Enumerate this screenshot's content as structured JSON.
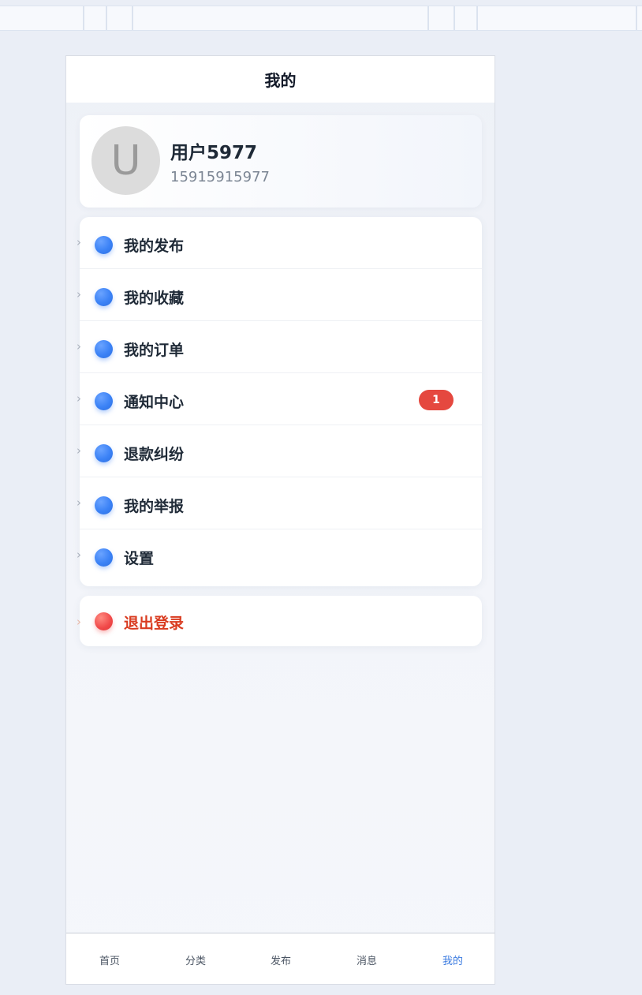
{
  "header": {
    "title": "我的"
  },
  "profile": {
    "avatar_letter": "U",
    "username": "用户5977",
    "phone": "15915915977"
  },
  "menu": [
    {
      "label": "我的发布",
      "icon": "blue-dot-icon"
    },
    {
      "label": "我的收藏",
      "icon": "blue-dot-icon"
    },
    {
      "label": "我的订单",
      "icon": "blue-dot-icon"
    },
    {
      "label": "通知中心",
      "icon": "blue-dot-icon",
      "badge": "1"
    },
    {
      "label": "退款纠纷",
      "icon": "blue-dot-icon"
    },
    {
      "label": "我的举报",
      "icon": "blue-dot-icon"
    },
    {
      "label": "设置",
      "icon": "blue-dot-icon"
    }
  ],
  "logout": {
    "label": "退出登录",
    "icon": "red-dot-icon"
  },
  "chevron_glyph": "›",
  "tabs": [
    {
      "label": "首页",
      "active": false
    },
    {
      "label": "分类",
      "active": false
    },
    {
      "label": "发布",
      "active": false
    },
    {
      "label": "消息",
      "active": false
    },
    {
      "label": "我的",
      "active": true
    }
  ],
  "colors": {
    "accent": "#3b82f6",
    "badge": "#e5483f",
    "logout_text": "#d93b20",
    "active_tab": "#3b7be0"
  }
}
